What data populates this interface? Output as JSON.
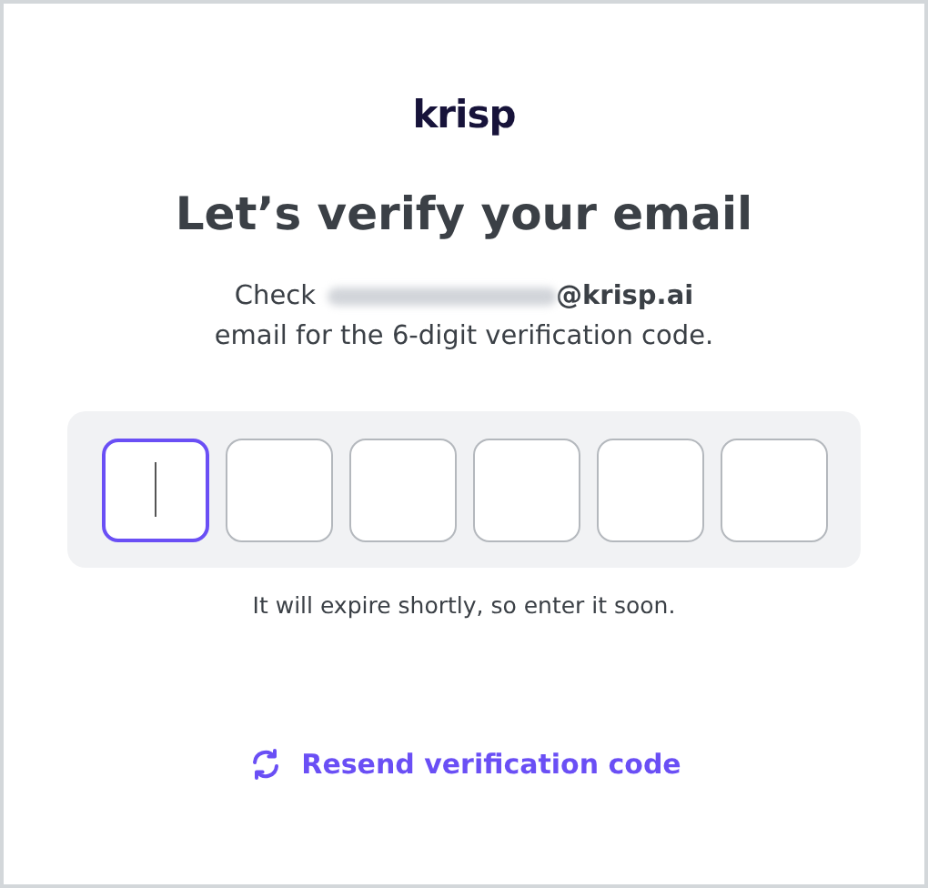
{
  "logo": "krisp",
  "title": "Let’s verify your email",
  "message": {
    "prefix": "Check",
    "email_redacted": true,
    "email_domain": "@krisp.ai",
    "line_2": "email for the 6-digit verification code."
  },
  "code_boxes": [
    {
      "focused": true
    },
    {
      "focused": false
    },
    {
      "focused": false
    },
    {
      "focused": false
    },
    {
      "focused": false
    },
    {
      "focused": false
    }
  ],
  "hint": "It will expire shortly, so enter it soon.",
  "resend_link": "Resend verification code"
}
